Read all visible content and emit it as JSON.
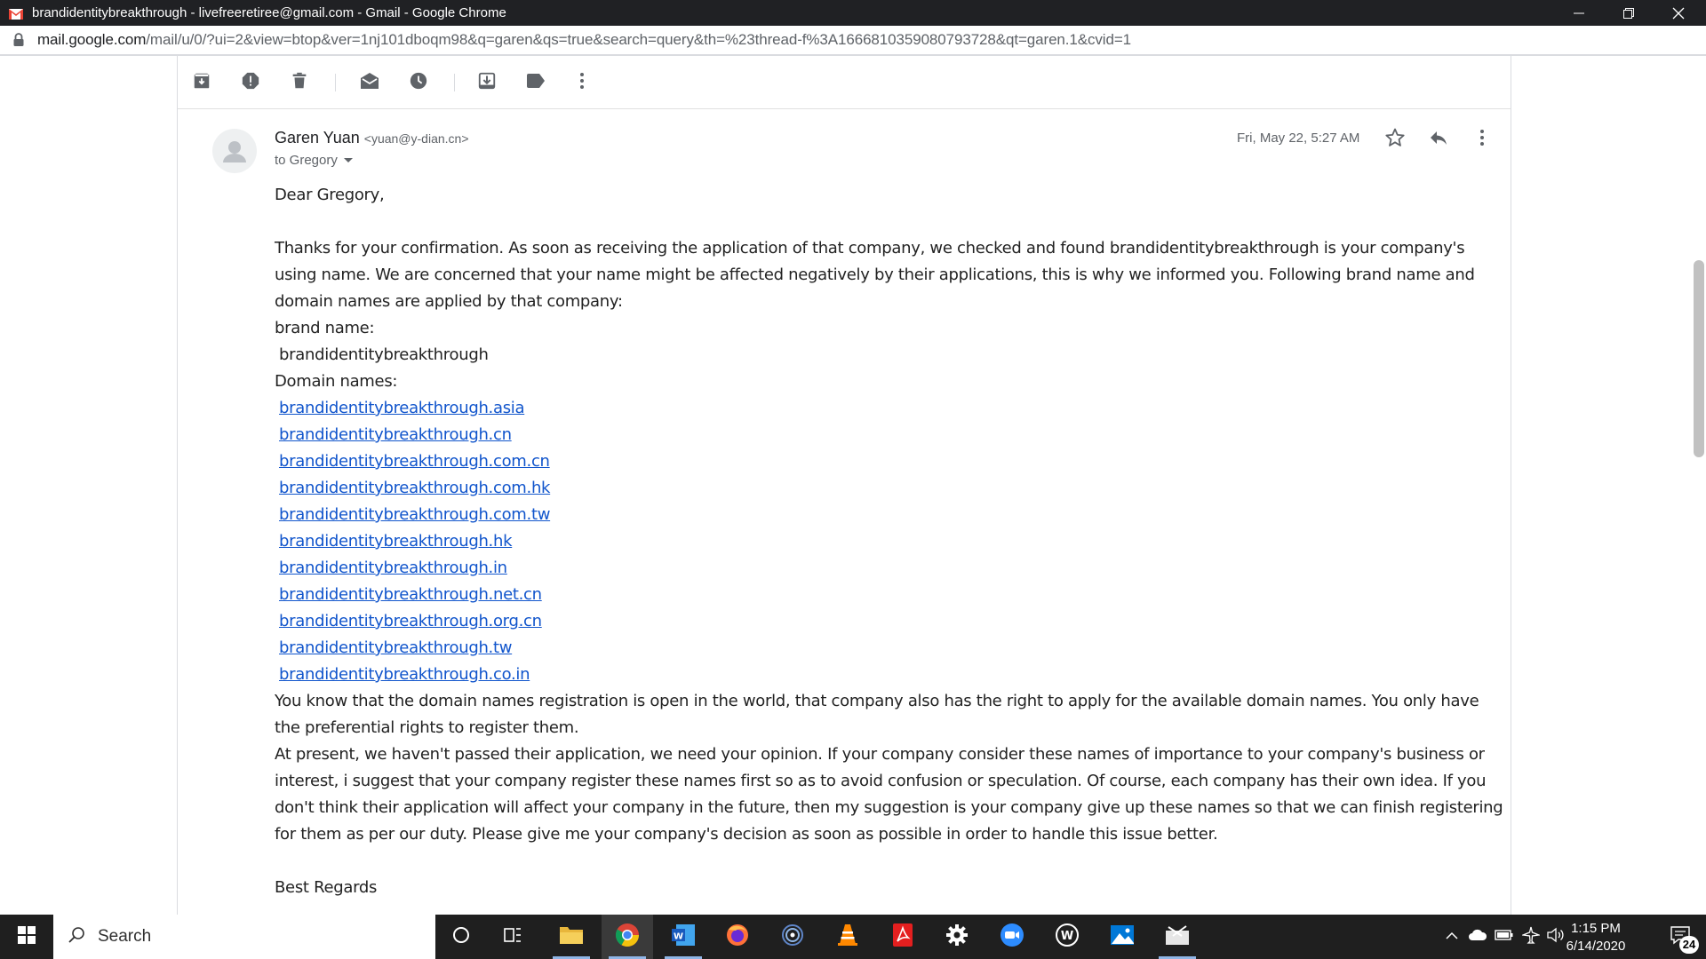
{
  "window": {
    "title": "brandidentitybreakthrough - livefreeretiree@gmail.com - Gmail - Google Chrome"
  },
  "address_bar": {
    "host": "mail.google.com",
    "path": "/mail/u/0/?ui=2&view=btop&ver=1nj101dboqm98&q=garen&qs=true&search=query&th=%23thread-f%3A1666810359080793728&qt=garen.1&cvid=1"
  },
  "toolbar": {
    "icons": [
      "archive-icon",
      "report-spam-icon",
      "delete-icon",
      "mark-unread-icon",
      "snooze-icon",
      "move-to-icon",
      "label-icon",
      "more-vert-icon"
    ]
  },
  "message": {
    "sender_name": "Garen Yuan",
    "sender_email": "<yuan@y-dian.cn>",
    "recipient": "to Gregory",
    "date": "Fri, May 22, 5:27 AM",
    "greeting": "Dear Gregory,",
    "para1": "Thanks for your confirmation. As soon as receiving the application of that company, we checked and found brandidentitybreakthrough is your company's using name. We are concerned that your name might be affected negatively by their applications, this is why we informed you. Following brand name and domain names are applied by that company:",
    "brand_label": "brand name:",
    "brand_name": "brandidentitybreakthrough",
    "domains_label": "Domain names:",
    "domains": [
      "brandidentitybreakthrough.asia",
      "brandidentitybreakthrough.cn",
      "brandidentitybreakthrough.com.cn",
      "brandidentitybreakthrough.com.hk",
      "brandidentitybreakthrough.com.tw",
      "brandidentitybreakthrough.hk",
      "brandidentitybreakthrough.in",
      "brandidentitybreakthrough.net.cn",
      "brandidentitybreakthrough.org.cn",
      "brandidentitybreakthrough.tw",
      "brandidentitybreakthrough.co.in"
    ],
    "para2": "You know that the domain names registration is open in the world, that company also has the right to apply for the available domain names. You only have the preferential rights to register them.",
    "para3": "At present, we haven't passed their application, we need your opinion. If your company consider these names of importance to your company's business or interest, i suggest that your company register these names first so as to avoid confusion or speculation. Of course, each company has their own idea. If you don't think their application will affect your company in the future, then my suggestion is your company give up these names so that we can finish registering for them as per our duty. Please give me your company's decision as soon as possible in order to handle this issue better.",
    "closing": "Best Regards"
  },
  "taskbar": {
    "search_label": "Search",
    "time": "1:15 PM",
    "date": "6/14/2020",
    "notification_count": "24",
    "colors": {
      "background": "#1f1f1f",
      "active_app": "#3a3a3a",
      "running_indicator": "#8fb5e6"
    }
  },
  "colors": {
    "link": "#1155cc",
    "titlebar": "#202124",
    "text": "#222222",
    "secondary_text": "#5f6368"
  }
}
